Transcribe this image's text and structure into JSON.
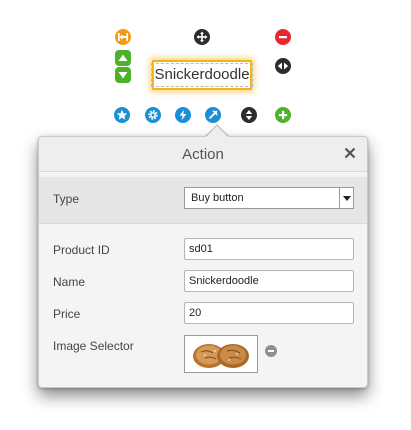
{
  "canvas": {
    "element_text": "Snickerdoodle"
  },
  "panel": {
    "title": "Action",
    "close_glyph": "✕",
    "type": {
      "label": "Type",
      "selected": "Buy button"
    },
    "product_id": {
      "label": "Product ID",
      "value": "sd01"
    },
    "name": {
      "label": "Name",
      "value": "Snickerdoodle"
    },
    "price": {
      "label": "Price",
      "value": "20"
    },
    "image_selector": {
      "label": "Image Selector",
      "image": "snickerdoodle-cookies-image"
    }
  },
  "controls": {
    "icons": [
      "align-icon",
      "move-icon",
      "delete-icon",
      "move-up-icon",
      "move-down-icon",
      "resize-horizontal-icon",
      "favorite-star-icon",
      "settings-gear-icon",
      "action-bolt-icon",
      "link-arrow-icon",
      "layer-order-icon",
      "add-icon"
    ],
    "colors": {
      "orange": "#f29b1b",
      "green": "#4cb227",
      "red": "#e6282f",
      "blue": "#1a8ed6",
      "dark": "#2c2c2c",
      "selection": "#f2b515"
    }
  }
}
